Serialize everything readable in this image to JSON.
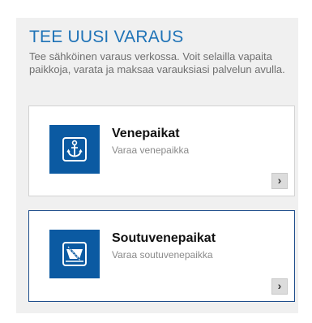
{
  "booking": {
    "title": "TEE UUSI VARAUS",
    "description": "Tee sähköinen varaus verkossa. Voit selailla vapaita paikkoja, varata ja maksaa varauksiasi palvelun avulla."
  },
  "options": [
    {
      "title": "Venepaikat",
      "subtitle": "Varaa venepaikka",
      "icon": "anchor-icon",
      "arrow": "›",
      "selected": false
    },
    {
      "title": "Soutuvenepaikat",
      "subtitle": "Varaa soutuvenepaikka",
      "icon": "rowboat-icon",
      "arrow": "›",
      "selected": true
    }
  ],
  "colors": {
    "accent": "#1f73b7",
    "icon_background": "#0b5aa2",
    "selected_border": "#1f4e8c",
    "panel_background": "#f0f0f0"
  }
}
